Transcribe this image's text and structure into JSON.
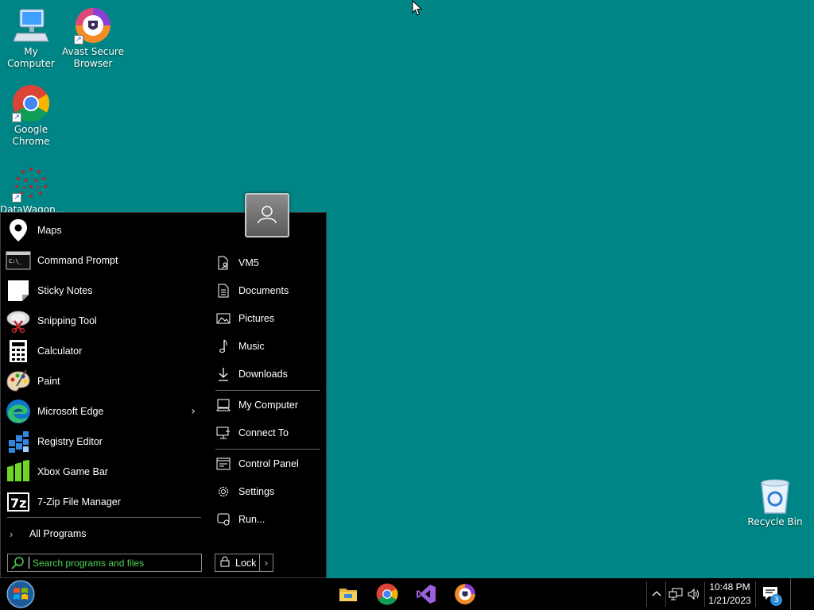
{
  "desktop": {
    "icons": [
      {
        "label": "My Computer",
        "icon": "computer-icon"
      },
      {
        "label": "Avast Secure Browser",
        "icon": "avast-browser-icon"
      },
      {
        "label": "Google Chrome",
        "icon": "chrome-icon"
      },
      {
        "label": "DataWagon...",
        "icon": "datawagon-icon"
      },
      {
        "label": "Recycle Bin",
        "icon": "recycle-bin-icon"
      }
    ]
  },
  "start_menu": {
    "programs": [
      {
        "label": "Maps",
        "icon": "maps-icon"
      },
      {
        "label": "Command Prompt",
        "icon": "command-prompt-icon"
      },
      {
        "label": "Sticky Notes",
        "icon": "sticky-notes-icon"
      },
      {
        "label": "Snipping Tool",
        "icon": "snipping-tool-icon"
      },
      {
        "label": "Calculator",
        "icon": "calculator-icon"
      },
      {
        "label": "Paint",
        "icon": "paint-icon"
      },
      {
        "label": "Microsoft Edge",
        "icon": "edge-icon"
      },
      {
        "label": "Registry Editor",
        "icon": "registry-editor-icon"
      },
      {
        "label": "Xbox Game Bar",
        "icon": "xbox-game-bar-icon"
      },
      {
        "label": "7-Zip File Manager",
        "icon": "7zip-icon"
      }
    ],
    "all_programs": "All Programs",
    "search_placeholder": "Search programs and files",
    "places": [
      {
        "label": "VM5",
        "icon": "user-folder-icon"
      },
      {
        "label": "Documents",
        "icon": "documents-icon"
      },
      {
        "label": "Pictures",
        "icon": "pictures-icon"
      },
      {
        "label": "Music",
        "icon": "music-icon"
      },
      {
        "label": "Downloads",
        "icon": "downloads-icon"
      },
      {
        "label": "My Computer",
        "icon": "computer-icon"
      },
      {
        "label": "Connect To",
        "icon": "connect-to-icon"
      },
      {
        "label": "Control Panel",
        "icon": "control-panel-icon"
      },
      {
        "label": "Settings",
        "icon": "settings-gear-icon"
      },
      {
        "label": "Run...",
        "icon": "run-icon"
      }
    ],
    "lock_label": "Lock"
  },
  "taskbar": {
    "pinned": [
      "file-explorer-icon",
      "chrome-icon",
      "visual-studio-icon",
      "avast-browser-icon"
    ],
    "clock": {
      "time": "10:48 PM",
      "date": "1/21/2023"
    },
    "notification_count": "3"
  },
  "colors": {
    "desktop_background": "#008586",
    "start_menu_background": "#000000",
    "search_placeholder": "#4fd34f",
    "notification_badge": "#2d8bd7"
  }
}
